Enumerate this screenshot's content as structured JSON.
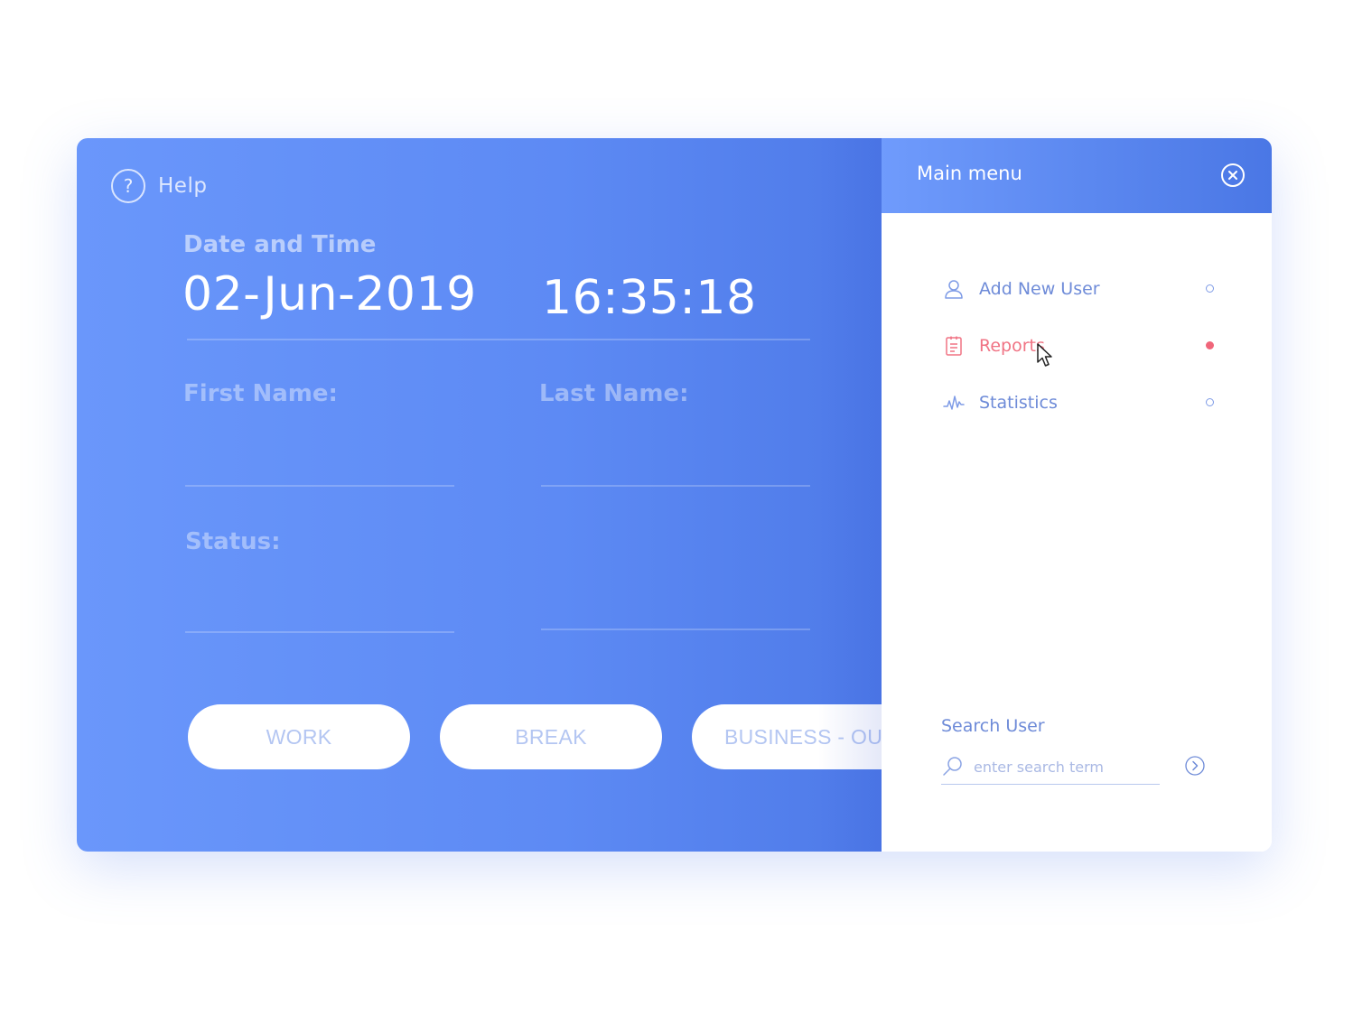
{
  "help": {
    "label": "Help",
    "icon": "help-icon"
  },
  "datetime": {
    "label": "Date and Time",
    "date": "02-Jun-2019",
    "time": "16:35:18"
  },
  "form": {
    "first_name_label": "First Name:",
    "last_name_label": "Last Name:",
    "status_label": "Status:",
    "first_name_value": "",
    "last_name_value": "",
    "status_value": ""
  },
  "buttons": {
    "work": "WORK",
    "break": "BREAK",
    "business_out": "BUSINESS - OUT"
  },
  "menu": {
    "title": "Main menu",
    "close_icon": "close-circle-icon",
    "items": [
      {
        "label": "Add New User",
        "icon": "user-icon",
        "active": false
      },
      {
        "label": "Reports",
        "icon": "clipboard-icon",
        "active": true
      },
      {
        "label": "Statistics",
        "icon": "activity-icon",
        "active": false
      }
    ]
  },
  "search": {
    "label": "Search User",
    "placeholder": "enter search term",
    "value": "",
    "icon": "search-icon",
    "submit_icon": "chevron-right-circle-icon"
  },
  "colors": {
    "accent": "#5d8af4",
    "active": "#f07384",
    "menu_text": "#6e8bd8"
  }
}
